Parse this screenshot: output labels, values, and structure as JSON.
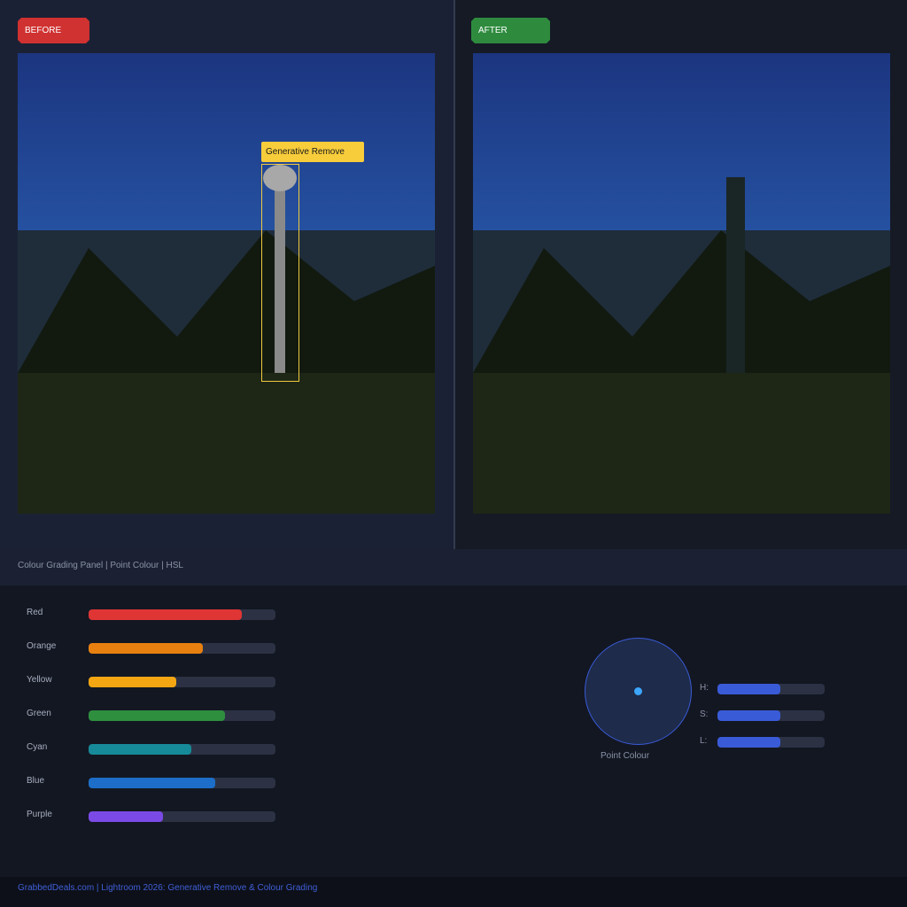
{
  "panes": {
    "before_label": "BEFORE",
    "after_label": "AFTER",
    "generative_label": "Generative Remove"
  },
  "colors": {
    "before_badge": "#d03131",
    "after_badge": "#2e8b3e",
    "selection": "#f1c93e",
    "accent": "#3a5bd8"
  },
  "tab_bar": {
    "text": "Colour Grading Panel  |  Point Colour  |  HSL"
  },
  "hsl": {
    "rows": [
      {
        "label": "Red",
        "value": 0.82,
        "color": "#e03535"
      },
      {
        "label": "Orange",
        "value": 0.61,
        "color": "#e8800f"
      },
      {
        "label": "Yellow",
        "value": 0.47,
        "color": "#f4a612"
      },
      {
        "label": "Green",
        "value": 0.73,
        "color": "#2e8f3f"
      },
      {
        "label": "Cyan",
        "value": 0.55,
        "color": "#168a98"
      },
      {
        "label": "Blue",
        "value": 0.68,
        "color": "#1d6ec8"
      },
      {
        "label": "Purple",
        "value": 0.4,
        "color": "#7b4ae6"
      }
    ]
  },
  "point_colour": {
    "caption": "Point Colour",
    "sliders": [
      {
        "label": "H:",
        "value": 0.59
      },
      {
        "label": "S:",
        "value": 0.59
      },
      {
        "label": "L:",
        "value": 0.59
      }
    ]
  },
  "footer": {
    "text": "GrabbedDeals.com | Lightroom 2026: Generative Remove & Colour Grading"
  }
}
